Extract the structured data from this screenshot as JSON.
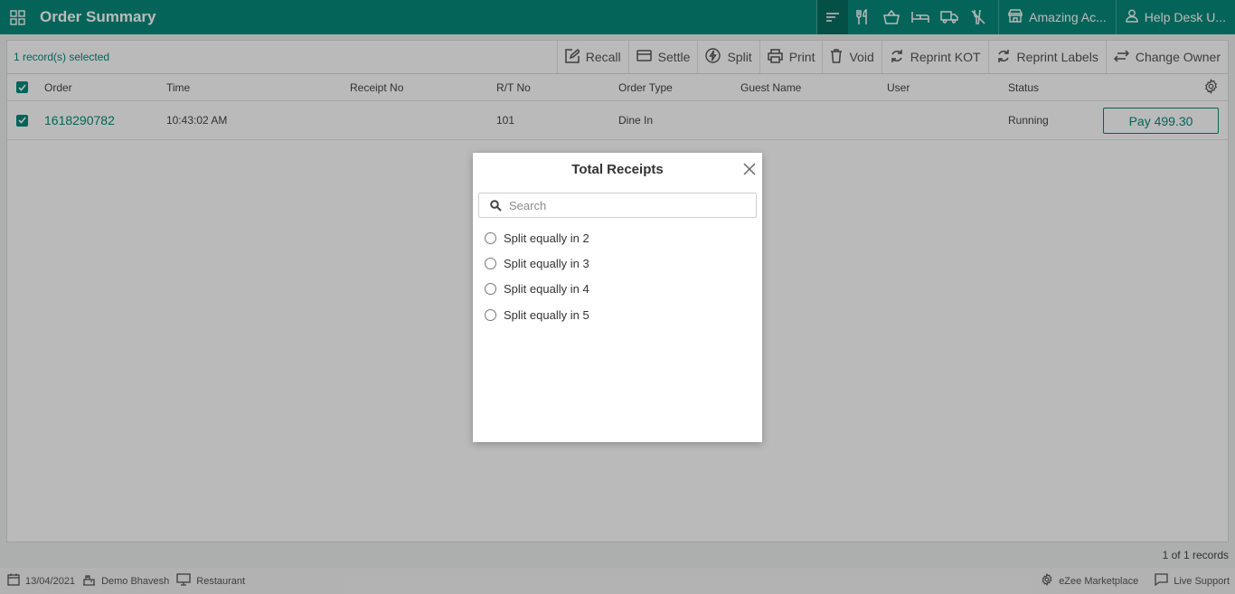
{
  "header": {
    "title": "Order Summary",
    "outlet": "Amazing Ac...",
    "user": "Help Desk U..."
  },
  "toolbar": {
    "selected": "1 record(s) selected",
    "actions": [
      "Recall",
      "Settle",
      "Split",
      "Print",
      "Void",
      "Reprint KOT",
      "Reprint Labels",
      "Change Owner"
    ]
  },
  "table": {
    "headers": [
      "Order",
      "Time",
      "Receipt No",
      "R/T No",
      "Order Type",
      "Guest Name",
      "User",
      "Status"
    ],
    "rows": [
      {
        "order": "1618290782",
        "time": "10:43:02 AM",
        "receipt": "",
        "rt": "101",
        "type": "Dine In",
        "guest": "",
        "user": "",
        "status": "Running",
        "pay": "Pay 499.30"
      }
    ]
  },
  "records": "1 of 1 records",
  "footer": {
    "date": "13/04/2021",
    "user": "Demo Bhavesh",
    "station": "Restaurant",
    "marketplace": "eZee Marketplace",
    "support": "Live Support"
  },
  "modal": {
    "title": "Total Receipts",
    "search_placeholder": "Search",
    "options": [
      "Split equally in 2",
      "Split equally in 3",
      "Split equally in 4",
      "Split equally in 5"
    ]
  },
  "colors": {
    "accent": "#07897a",
    "accent_dark": "#066d61"
  }
}
